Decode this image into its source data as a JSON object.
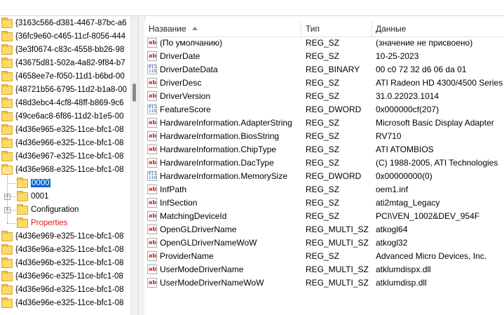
{
  "tree": {
    "items": [
      {
        "label": "{3163c566-d381-4467-87bc-a6",
        "icon": "folder-icon"
      },
      {
        "label": "{36fc9e60-c465-11cf-8056-444",
        "icon": "folder-icon"
      },
      {
        "label": "{3e3f0674-c83c-4558-bb26-98",
        "icon": "folder-icon"
      },
      {
        "label": "{43675d81-502a-4a82-9f84-b7",
        "icon": "folder-icon"
      },
      {
        "label": "{4658ee7e-f050-11d1-b6bd-00",
        "icon": "folder-icon"
      },
      {
        "label": "{48721b56-6795-11d2-b1a8-00",
        "icon": "folder-icon"
      },
      {
        "label": "{48d3ebc4-4cf8-48ff-b869-9c6",
        "icon": "folder-icon"
      },
      {
        "label": "{49ce6ac8-6f86-11d2-b1e5-00",
        "icon": "folder-icon"
      },
      {
        "label": "{4d36e965-e325-11ce-bfc1-08",
        "icon": "folder-icon"
      },
      {
        "label": "{4d36e966-e325-11ce-bfc1-08",
        "icon": "folder-icon"
      },
      {
        "label": "{4d36e967-e325-11ce-bfc1-08",
        "icon": "folder-icon"
      },
      {
        "label": "{4d36e968-e325-11ce-bfc1-08",
        "icon": "folder-open-icon"
      }
    ],
    "children": [
      {
        "label": "0000",
        "selected": true
      },
      {
        "label": "0001"
      },
      {
        "label": "Configuration"
      },
      {
        "label": "Properties",
        "color": "#e21a1a"
      }
    ],
    "items_after": [
      {
        "label": "{4d36e969-e325-11ce-bfc1-08"
      },
      {
        "label": "{4d36e96a-e325-11ce-bfc1-08"
      },
      {
        "label": "{4d36e96b-e325-11ce-bfc1-08"
      },
      {
        "label": "{4d36e96c-e325-11ce-bfc1-08"
      },
      {
        "label": "{4d36e96d-e325-11ce-bfc1-08"
      },
      {
        "label": "{4d36e96e-e325-11ce-bfc1-08"
      }
    ],
    "selection_color": "#0a64d2"
  },
  "list": {
    "columns": [
      "Название",
      "Тип",
      "Данные"
    ],
    "rows": [
      {
        "icon": "string-value-icon",
        "name": "(По умолчанию)",
        "type": "REG_SZ",
        "data": "(значение не присвоено)"
      },
      {
        "icon": "string-value-icon",
        "name": "DriverDate",
        "type": "REG_SZ",
        "data": "10-25-2023"
      },
      {
        "icon": "binary-value-icon",
        "name": "DriverDateData",
        "type": "REG_BINARY",
        "data": "00 c0 72 32 d6 06 da 01"
      },
      {
        "icon": "string-value-icon",
        "name": "DriverDesc",
        "type": "REG_SZ",
        "data": "ATI Radeon HD 4300/4500 Series"
      },
      {
        "icon": "string-value-icon",
        "name": "DriverVersion",
        "type": "REG_SZ",
        "data": "31.0.22023.1014"
      },
      {
        "icon": "binary-value-icon",
        "name": "FeatureScore",
        "type": "REG_DWORD",
        "data": "0x000000cf(207)"
      },
      {
        "icon": "string-value-icon",
        "name": "HardwareInformation.AdapterString",
        "type": "REG_SZ",
        "data": "Microsoft Basic Display Adapter"
      },
      {
        "icon": "string-value-icon",
        "name": "HardwareInformation.BiosString",
        "type": "REG_SZ",
        "data": "RV710"
      },
      {
        "icon": "string-value-icon",
        "name": "HardwareInformation.ChipType",
        "type": "REG_SZ",
        "data": "ATI ATOMBIOS"
      },
      {
        "icon": "string-value-icon",
        "name": "HardwareInformation.DacType",
        "type": "REG_SZ",
        "data": "(C) 1988-2005, ATI Technologies"
      },
      {
        "icon": "binary-value-icon",
        "name": "HardwareInformation.MemorySize",
        "type": "REG_DWORD",
        "data": "0x00000000(0)"
      },
      {
        "icon": "string-value-icon",
        "name": "InfPath",
        "type": "REG_SZ",
        "data": "oem1.inf"
      },
      {
        "icon": "string-value-icon",
        "name": "InfSection",
        "type": "REG_SZ",
        "data": "ati2mtag_Legacy"
      },
      {
        "icon": "string-value-icon",
        "name": "MatchingDeviceId",
        "type": "REG_SZ",
        "data": "PCI\\VEN_1002&DEV_954F"
      },
      {
        "icon": "string-value-icon",
        "name": "OpenGLDriverName",
        "type": "REG_MULTI_SZ",
        "data": "atkogl64"
      },
      {
        "icon": "string-value-icon",
        "name": "OpenGLDriverNameWoW",
        "type": "REG_MULTI_SZ",
        "data": "atkogl32"
      },
      {
        "icon": "string-value-icon",
        "name": "ProviderName",
        "type": "REG_SZ",
        "data": "Advanced Micro Devices, Inc."
      },
      {
        "icon": "string-value-icon",
        "name": "UserModeDriverName",
        "type": "REG_MULTI_SZ",
        "data": "atklumdispx.dll"
      },
      {
        "icon": "string-value-icon",
        "name": "UserModeDriverNameWoW",
        "type": "REG_MULTI_SZ",
        "data": "atklumdisp.dll"
      }
    ]
  }
}
